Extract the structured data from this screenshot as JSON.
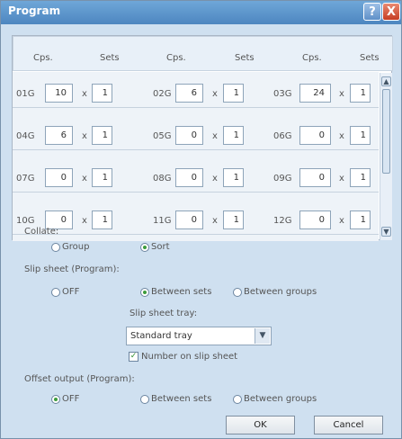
{
  "window": {
    "title": "Program",
    "help": "?",
    "close": "X"
  },
  "headers": [
    "Cps.",
    "Sets",
    "Cps.",
    "Sets",
    "Cps.",
    "Sets"
  ],
  "cells": [
    {
      "id": "01G",
      "copies": "10",
      "sets": "1"
    },
    {
      "id": "02G",
      "copies": "6",
      "sets": "1"
    },
    {
      "id": "03G",
      "copies": "24",
      "sets": "1"
    },
    {
      "id": "04G",
      "copies": "6",
      "sets": "1"
    },
    {
      "id": "05G",
      "copies": "0",
      "sets": "1"
    },
    {
      "id": "06G",
      "copies": "0",
      "sets": "1"
    },
    {
      "id": "07G",
      "copies": "0",
      "sets": "1"
    },
    {
      "id": "08G",
      "copies": "0",
      "sets": "1"
    },
    {
      "id": "09G",
      "copies": "0",
      "sets": "1"
    },
    {
      "id": "10G",
      "copies": "0",
      "sets": "1"
    },
    {
      "id": "11G",
      "copies": "0",
      "sets": "1"
    },
    {
      "id": "12G",
      "copies": "0",
      "sets": "1"
    }
  ],
  "times": "x",
  "collate": {
    "label": "Collate:",
    "group": "Group",
    "sort": "Sort"
  },
  "slip": {
    "label": "Slip sheet (Program):",
    "off": "OFF",
    "between_sets": "Between sets",
    "between_groups": "Between groups",
    "tray_label": "Slip sheet tray:",
    "tray_value": "Standard tray",
    "number_label": "Number on slip sheet"
  },
  "offset": {
    "label": "Offset output (Program):",
    "off": "OFF",
    "between_sets": "Between sets",
    "between_groups": "Between groups"
  },
  "buttons": {
    "ok": "OK",
    "cancel": "Cancel"
  }
}
